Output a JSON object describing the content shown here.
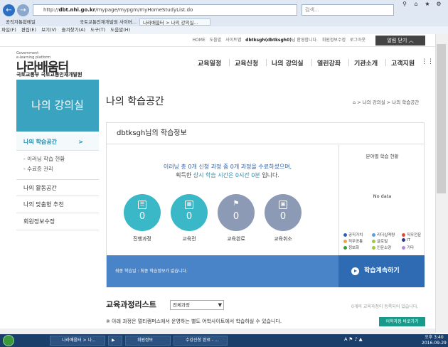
{
  "browser": {
    "url_prefix": "http://",
    "url_host": "dbt.nhi.go.kr",
    "url_path": "/mypage/mypgm/myHomeStudyList.do",
    "search_placeholder": "검색...",
    "favorites": [
      "공직자통합메일",
      "국토교통인재개발원 사이버...",
      "나라배움터 > 나의 강의실..."
    ],
    "menu": [
      "파일(F)",
      "편집(E)",
      "보기(V)",
      "즐겨찾기(A)",
      "도구(T)",
      "도움말(H)"
    ]
  },
  "header": {
    "toplinks": [
      "HOME",
      "도움말",
      "사이트맵"
    ],
    "welcome_user": "dbtksgh(dbtksgh0)",
    "welcome_suffix": "님 환영합니다.",
    "member_info": "회원정보수정",
    "logout": "로그아웃",
    "close_all": "알림 닫기 ︿",
    "logo_small_1": "Government",
    "logo_small_2": "e-learning platform",
    "logo": "나라배움터",
    "logo_sub": "국토교통부 국토교통인재개발원",
    "gnb": [
      "교육일정",
      "교육신청",
      "나의 강의실",
      "열린강좌",
      "기관소개",
      "고객지원"
    ]
  },
  "sidebar": {
    "title": "나의 강의실",
    "items": [
      "나의 학습공간",
      "나의 활동공간",
      "나의 맞춤형 추천",
      "회원정보수정"
    ],
    "sub_items": [
      "- 이러닝 학습 현황",
      "- 수료증 관리"
    ],
    "active_chevron": ">"
  },
  "main": {
    "title": "나의 학습공간",
    "breadcrumb": "> 나의 강의실 > 나의 학습공간",
    "info_title": "dbtksgh님의 학습정보",
    "msg1": "이러닝 총 0개 신청 과정 중 0개 과정을 수료하셨으며,",
    "msg2_a": "획득한 ",
    "msg2_b": "상시 학습 시간은 0시간 0분",
    "msg2_c": " 입니다.",
    "stats": [
      {
        "label": "진행과정",
        "value": "0",
        "color": "#3ab8c8",
        "icon": "book-icon"
      },
      {
        "label": "교육전",
        "value": "0",
        "color": "#3ab8c8",
        "icon": "calendar-icon"
      },
      {
        "label": "교육완료",
        "value": "0",
        "color": "#8c9ab5",
        "icon": "flag-icon"
      },
      {
        "label": "교육취소",
        "value": "0",
        "color": "#8c9ab5",
        "icon": "screen-icon"
      }
    ],
    "field_status_title": "분야별 학습 현황",
    "no_data": "No data",
    "legend": [
      {
        "name": "공직가치",
        "color": "#2a62b8"
      },
      {
        "name": "리더십역량",
        "color": "#5aa0d8"
      },
      {
        "name": "직무전문",
        "color": "#e24a3a"
      },
      {
        "name": "직무공통",
        "color": "#f2a43a"
      },
      {
        "name": "글로벌",
        "color": "#9ac93a"
      },
      {
        "name": "IT",
        "color": "#2a3a8a"
      },
      {
        "name": "정보화",
        "color": "#3a9a3a"
      },
      {
        "name": "인문소양",
        "color": "#a0c83a"
      },
      {
        "name": "기타",
        "color": "#b08ad8"
      }
    ],
    "recent_text": "최종 학습일 : 최종 학습정보가 없습니다.",
    "continue_label": "학습계속하기",
    "list_title": "교육과정리스트",
    "list_select": "전체과정",
    "list_count": "0개의 교육과정이 등록되어 있습니다.",
    "notice": "※ 아래 과정은 멀티캠퍼스에서 운영하는 별도 어학사이트에서 학습하실 수 있습니다.",
    "lang_button": "어학과정 바로가기"
  },
  "taskbar": {
    "buttons": [
      "나라배움터 > 나...",
      "",
      "회원정보",
      "수강신청 완료 - ..."
    ],
    "clock_time": "오후 3:40",
    "clock_date": "2016-09-29"
  }
}
